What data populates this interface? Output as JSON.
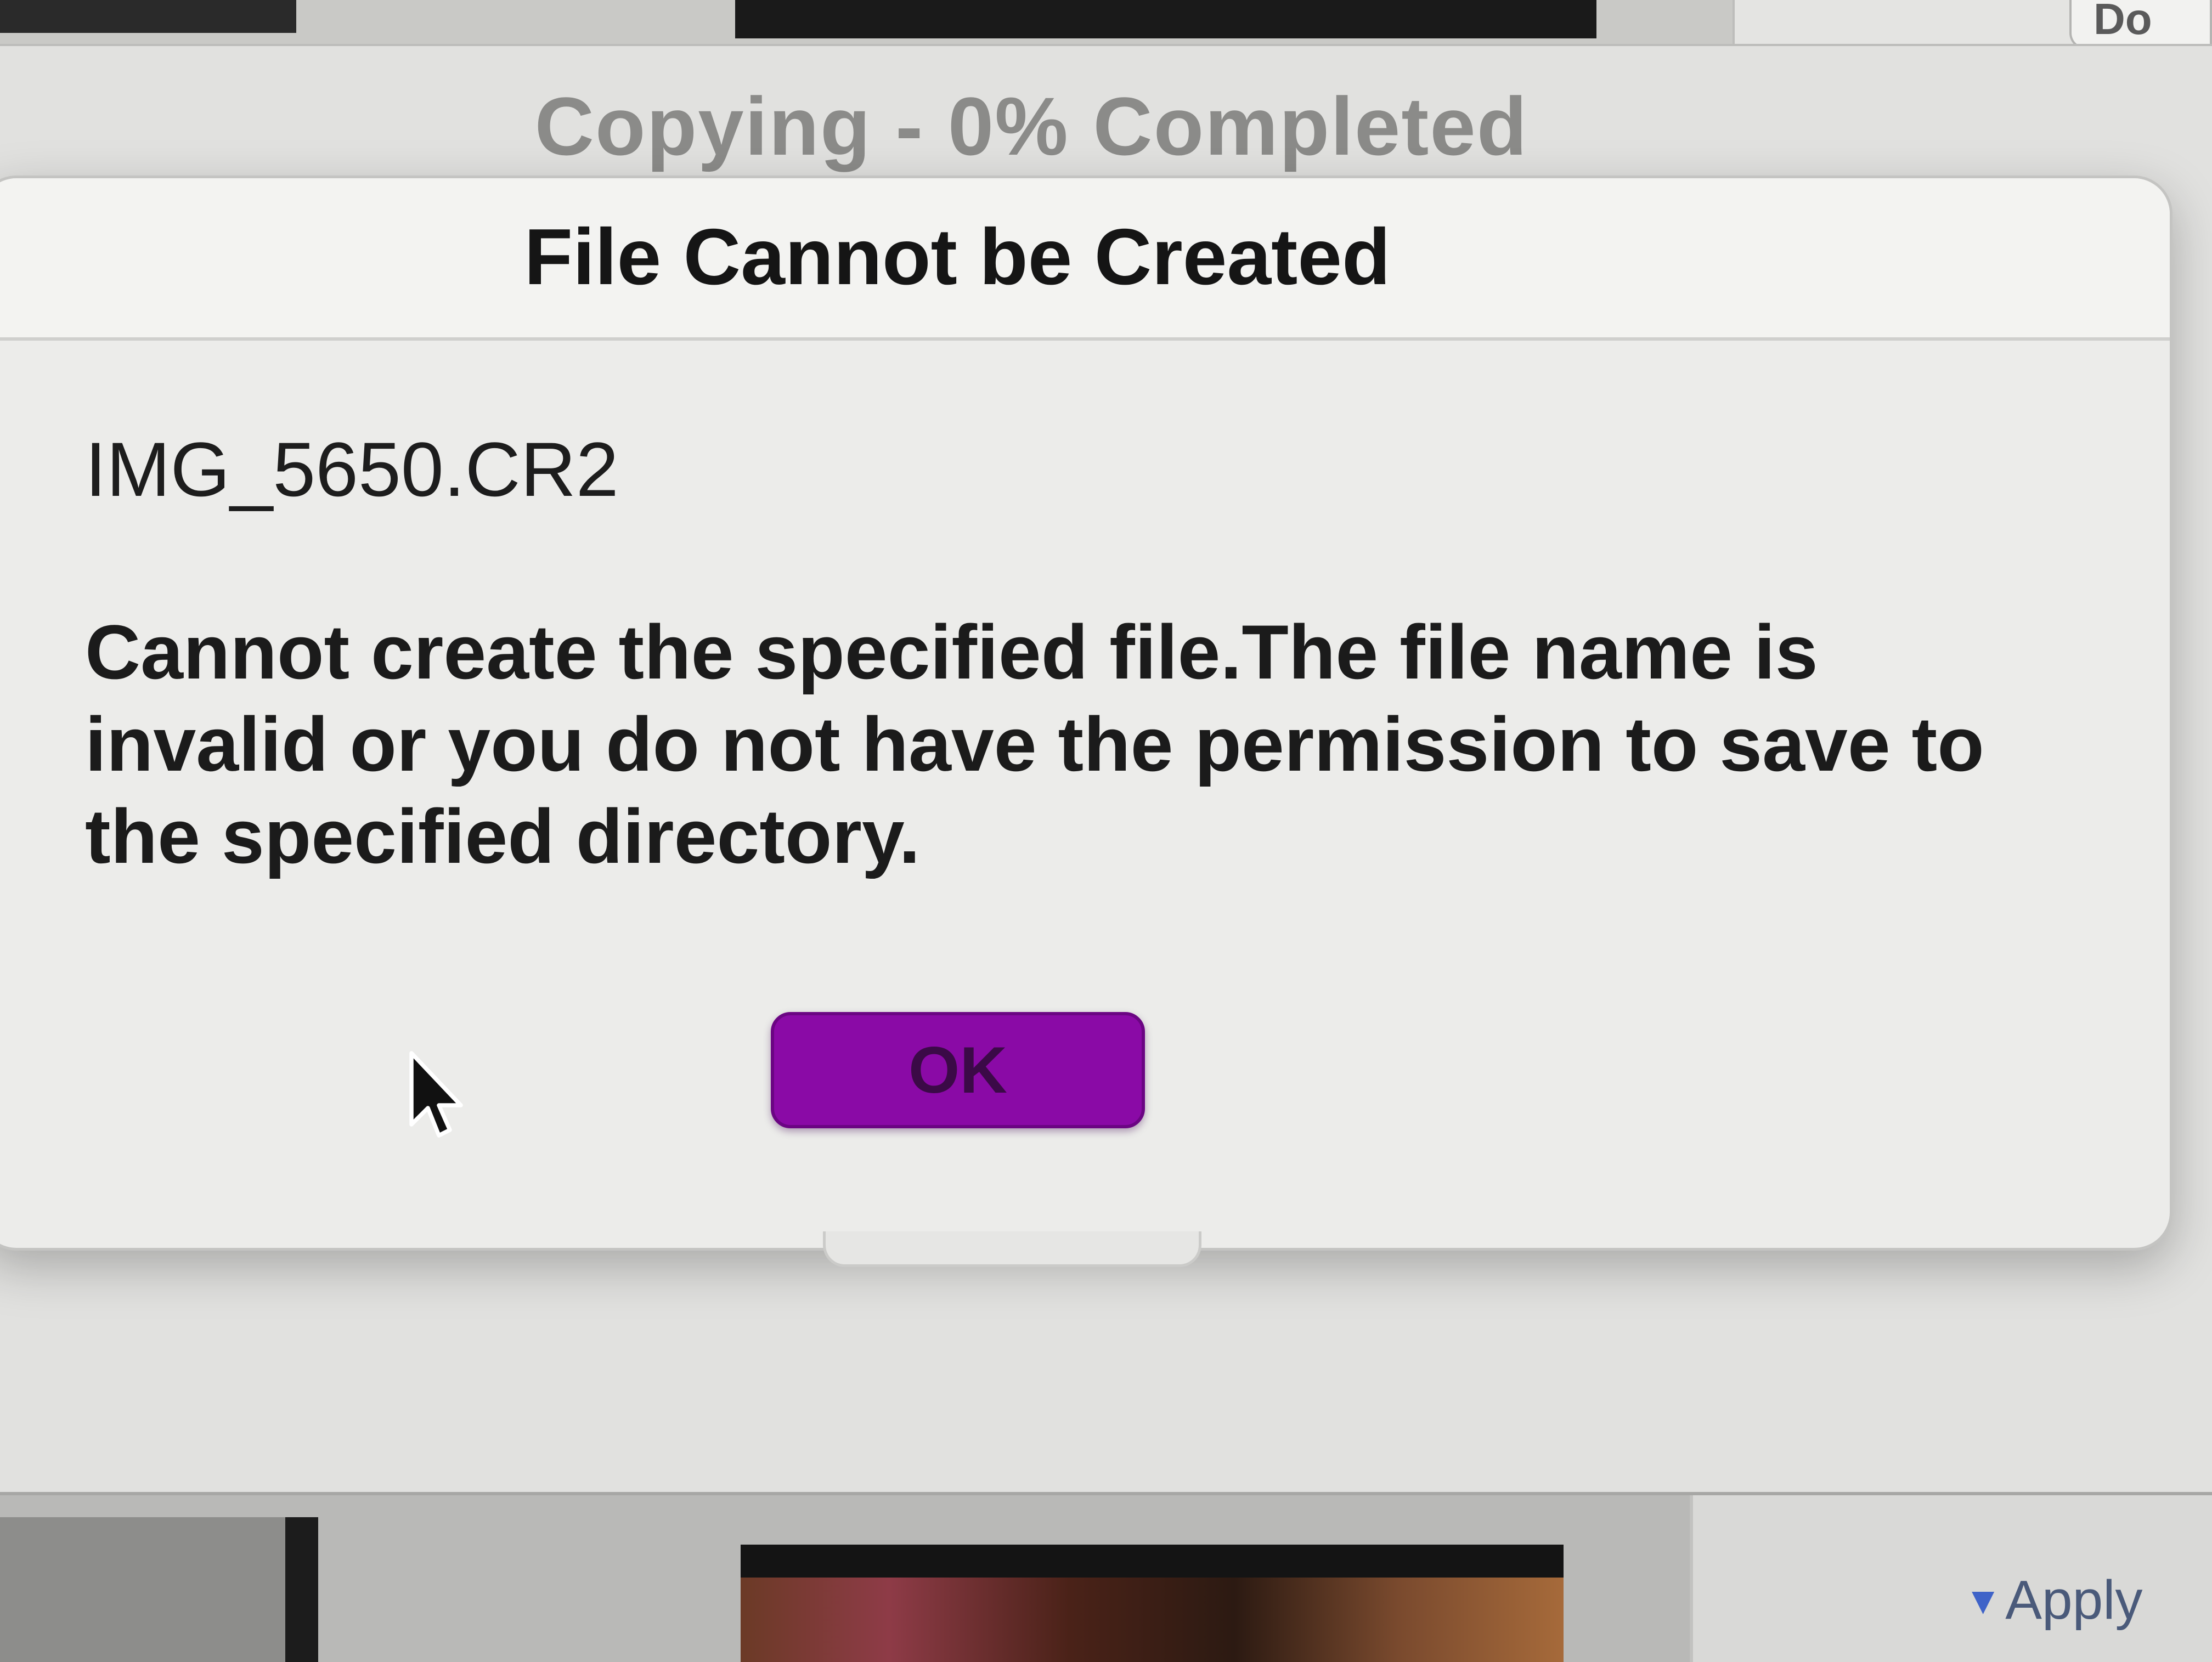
{
  "background": {
    "top_button_label": "Do",
    "apply_label": "Apply"
  },
  "progress": {
    "title": "Copying - 0% Completed",
    "percent": 0
  },
  "alert": {
    "title": "File Cannot be Created",
    "file_name": "IMG_5650.CR2",
    "message": "Cannot create the specified file.The file name is invalid or you do not have the permission to save to the specified directory.",
    "ok_label": "OK",
    "ok_color": "#8a0aa6"
  },
  "icons": {
    "cursor": "arrow-cursor-icon",
    "apply": "triangle-down-icon"
  }
}
